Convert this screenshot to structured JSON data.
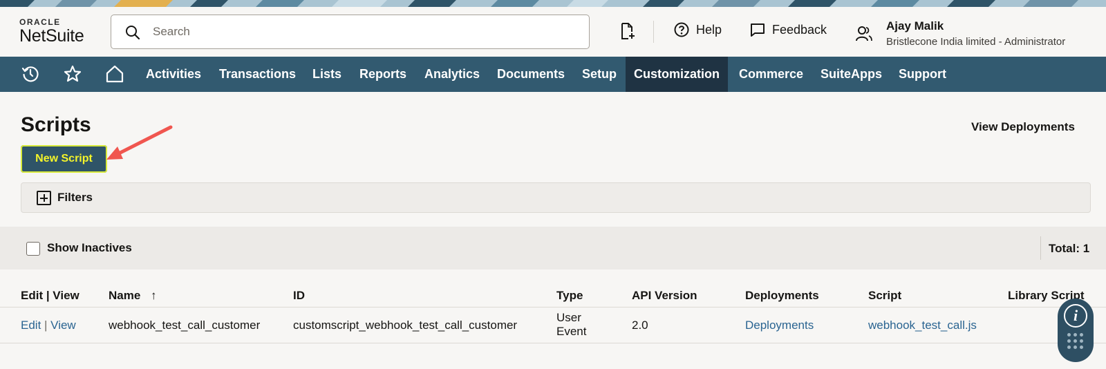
{
  "header": {
    "logo_top": "ORACLE",
    "logo_bottom": "NetSuite",
    "search_placeholder": "Search",
    "help_label": "Help",
    "feedback_label": "Feedback",
    "user_name": "Ajay Malik",
    "user_role": "Bristlecone India limited  -  Administrator"
  },
  "nav": {
    "items": [
      "Activities",
      "Transactions",
      "Lists",
      "Reports",
      "Analytics",
      "Documents",
      "Setup",
      "Customization",
      "Commerce",
      "SuiteApps",
      "Support"
    ],
    "active": "Customization"
  },
  "page": {
    "title": "Scripts",
    "view_deployments": "View Deployments",
    "new_script_label": "New Script",
    "filters_label": "Filters",
    "show_inactives_label": "Show Inactives",
    "total_label": "Total: 1"
  },
  "table": {
    "columns": [
      "Edit | View",
      "Name",
      "ID",
      "Type",
      "API Version",
      "Deployments",
      "Script",
      "Library Script"
    ],
    "sort_indicator": "↑",
    "rows": [
      {
        "edit": "Edit",
        "view": "View",
        "name": "webhook_test_call_customer",
        "id": "customscript_webhook_test_call_customer",
        "type_line1": "User",
        "type_line2": "Event",
        "api_version": "2.0",
        "deployments": "Deployments",
        "script": "webhook_test_call.js",
        "library_script": ""
      }
    ]
  },
  "widget": {
    "info_glyph": "i"
  },
  "colors": {
    "nav_bg": "#325a70",
    "nav_active_bg": "#1f3343",
    "button_bg": "#2f5468",
    "link": "#2a6491",
    "highlight": "#f4f42a",
    "annotation_arrow": "#f0564f"
  }
}
